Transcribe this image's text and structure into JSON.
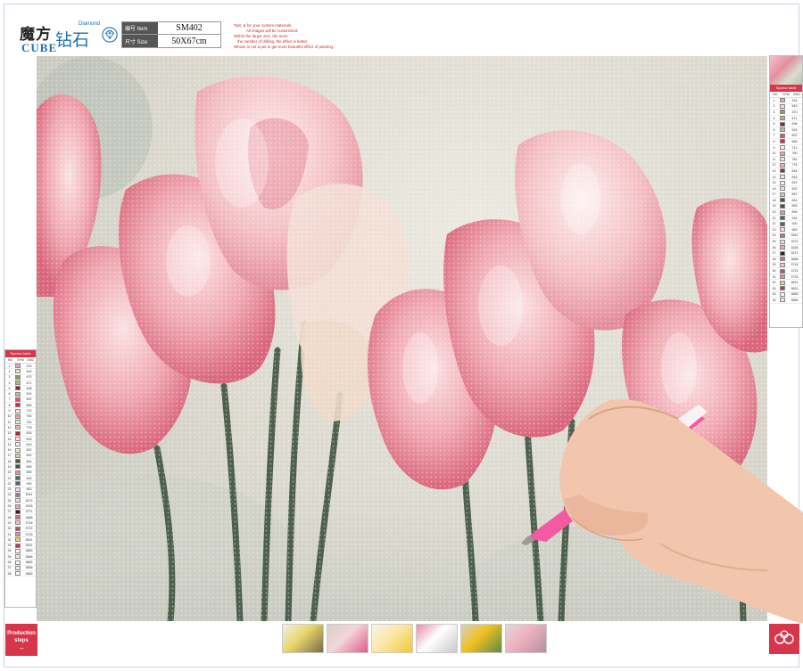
{
  "brand": {
    "chinese_name": "魔方",
    "english_name": "CUBE",
    "diamond_chinese": "钻石",
    "diamond_small": "Diamond"
  },
  "spec_table": {
    "item_key": "编号 Item",
    "item_value": "SM402",
    "size_key": "尺寸 Size",
    "size_value": "50X67cm"
  },
  "tips": [
    "Tips: & for your custom materials:",
    "All images will be customized.",
    "Within the larger size, the more",
    "the number of drilling, the effect is better.",
    "Whose is not a pet to get more beautiful effect of painting."
  ],
  "color_key_title": "Symbol table",
  "color_key_header": [
    "NO",
    "SYM",
    "DMC"
  ],
  "color_key_right": [
    {
      "n": "1",
      "c": "224",
      "color": "#e8a8ae"
    },
    {
      "n": "2",
      "c": "543",
      "color": "#f1ddd0"
    },
    {
      "n": "3",
      "c": "470",
      "color": "#8aa050"
    },
    {
      "n": "4",
      "c": "471",
      "color": "#a8bc6a"
    },
    {
      "n": "5",
      "c": "498",
      "color": "#9c1c2c"
    },
    {
      "n": "6",
      "c": "524",
      "color": "#b4bc9e"
    },
    {
      "n": "7",
      "c": "602",
      "color": "#e2506e"
    },
    {
      "n": "8",
      "c": "666",
      "color": "#e2222c"
    },
    {
      "n": "9",
      "c": "712",
      "color": "#f8f0e2"
    },
    {
      "n": "10",
      "c": "760",
      "color": "#f09aa2"
    },
    {
      "n": "11",
      "c": "762",
      "color": "#e4e4e2"
    },
    {
      "n": "12",
      "c": "778",
      "color": "#e0b6b2"
    },
    {
      "n": "13",
      "c": "816",
      "color": "#a8242e"
    },
    {
      "n": "14",
      "c": "818",
      "color": "#fcdcde"
    },
    {
      "n": "15",
      "c": "819",
      "color": "#fcebea"
    },
    {
      "n": "16",
      "c": "822",
      "color": "#ece6d8"
    },
    {
      "n": "17",
      "c": "842",
      "color": "#d8c6ac"
    },
    {
      "n": "18",
      "c": "844",
      "color": "#505050"
    },
    {
      "n": "19",
      "c": "895",
      "color": "#3a5a2c"
    },
    {
      "n": "20",
      "c": "899",
      "color": "#f08a98"
    },
    {
      "n": "21",
      "c": "924",
      "color": "#4c6664"
    },
    {
      "n": "22",
      "c": "930",
      "color": "#4c6278"
    },
    {
      "n": "23",
      "c": "963",
      "color": "#fcd4dc"
    },
    {
      "n": "24",
      "c": "3041",
      "color": "#9c7c92"
    },
    {
      "n": "25",
      "c": "3072",
      "color": "#dfe4dc"
    },
    {
      "n": "26",
      "c": "3326",
      "color": "#f2a2ae"
    },
    {
      "n": "27",
      "c": "3371",
      "color": "#2e201a"
    },
    {
      "n": "28",
      "c": "3688",
      "color": "#c8707e"
    },
    {
      "n": "29",
      "c": "3716",
      "color": "#f6bcc4"
    },
    {
      "n": "30",
      "c": "3722",
      "color": "#b8505e"
    },
    {
      "n": "31",
      "c": "3733",
      "color": "#e88896"
    },
    {
      "n": "32",
      "c": "3821",
      "color": "#f2cc6c"
    },
    {
      "n": "33",
      "c": "3831",
      "color": "#b83a54"
    },
    {
      "n": "34",
      "c": "3865",
      "color": "#faf6f0"
    },
    {
      "n": "35",
      "c": "3866",
      "color": "#f0e8dc"
    }
  ],
  "color_key_left": [
    {
      "n": "1",
      "c": "224",
      "color": "#e8a8ae"
    },
    {
      "n": "2",
      "c": "543",
      "color": "#f1ddd0"
    },
    {
      "n": "3",
      "c": "470",
      "color": "#8aa050"
    },
    {
      "n": "4",
      "c": "471",
      "color": "#a8bc6a"
    },
    {
      "n": "5",
      "c": "498",
      "color": "#9c1c2c"
    },
    {
      "n": "6",
      "c": "524",
      "color": "#b4bc9e"
    },
    {
      "n": "7",
      "c": "602",
      "color": "#e2506e"
    },
    {
      "n": "8",
      "c": "666",
      "color": "#e2222c"
    },
    {
      "n": "9",
      "c": "712",
      "color": "#f8f0e2"
    },
    {
      "n": "10",
      "c": "760",
      "color": "#f09aa2"
    },
    {
      "n": "11",
      "c": "762",
      "color": "#e4e4e2"
    },
    {
      "n": "12",
      "c": "778",
      "color": "#e0b6b2"
    },
    {
      "n": "13",
      "c": "816",
      "color": "#a8242e"
    },
    {
      "n": "14",
      "c": "818",
      "color": "#fcdcde"
    },
    {
      "n": "15",
      "c": "819",
      "color": "#fcebea"
    },
    {
      "n": "16",
      "c": "822",
      "color": "#ece6d8"
    },
    {
      "n": "17",
      "c": "842",
      "color": "#d8c6ac"
    },
    {
      "n": "18",
      "c": "844",
      "color": "#505050"
    },
    {
      "n": "19",
      "c": "895",
      "color": "#3a5a2c"
    },
    {
      "n": "20",
      "c": "899",
      "color": "#f08a98"
    },
    {
      "n": "21",
      "c": "924",
      "color": "#4c6664"
    },
    {
      "n": "22",
      "c": "930",
      "color": "#4c6278"
    },
    {
      "n": "23",
      "c": "963",
      "color": "#fcd4dc"
    },
    {
      "n": "24",
      "c": "3041",
      "color": "#9c7c92"
    },
    {
      "n": "25",
      "c": "3072",
      "color": "#dfe4dc"
    },
    {
      "n": "26",
      "c": "3326",
      "color": "#f2a2ae"
    },
    {
      "n": "27",
      "c": "3371",
      "color": "#2e201a"
    },
    {
      "n": "28",
      "c": "3688",
      "color": "#c8707e"
    },
    {
      "n": "29",
      "c": "3716",
      "color": "#f6bcc4"
    },
    {
      "n": "30",
      "c": "3722",
      "color": "#b8505e"
    },
    {
      "n": "31",
      "c": "3733",
      "color": "#e88896"
    },
    {
      "n": "32",
      "c": "3821",
      "color": "#f2cc6c"
    },
    {
      "n": "33",
      "c": "3831",
      "color": "#b83a54"
    },
    {
      "n": "34",
      "c": "3865",
      "color": "#faf6f0"
    },
    {
      "n": "35",
      "c": "3866",
      "color": "#f0e8dc"
    },
    {
      "n": "36",
      "c": "3865",
      "color": "#faf6f0"
    },
    {
      "n": "37",
      "c": "3866",
      "color": "#f0e8dc"
    },
    {
      "n": "38",
      "c": "3865",
      "color": "#faf6f0"
    }
  ],
  "production_steps": {
    "line1": "Production",
    "line2": "steps",
    "arrow": "→"
  },
  "step_thumbnails": [
    {
      "name": "step-1-kit",
      "colors": [
        "#e8d66a",
        "#7a6a4a",
        "#f2efe6"
      ]
    },
    {
      "name": "step-2-peel",
      "colors": [
        "#f2d6da",
        "#e05a8a",
        "#d8cfc8"
      ]
    },
    {
      "name": "step-3-tray",
      "colors": [
        "#fbe8a8",
        "#f0c838",
        "#f6f2e8"
      ]
    },
    {
      "name": "step-4-film",
      "colors": [
        "#ffffff",
        "#c8c8c8",
        "#e88aa6"
      ]
    },
    {
      "name": "step-5-sunflower",
      "colors": [
        "#f0c020",
        "#5a8a4a",
        "#d8d0c0"
      ]
    },
    {
      "name": "step-6-frame",
      "colors": [
        "#f0b0c0",
        "#b090a0",
        "#e0d8d8"
      ]
    }
  ],
  "accent_red": "#d7364a"
}
